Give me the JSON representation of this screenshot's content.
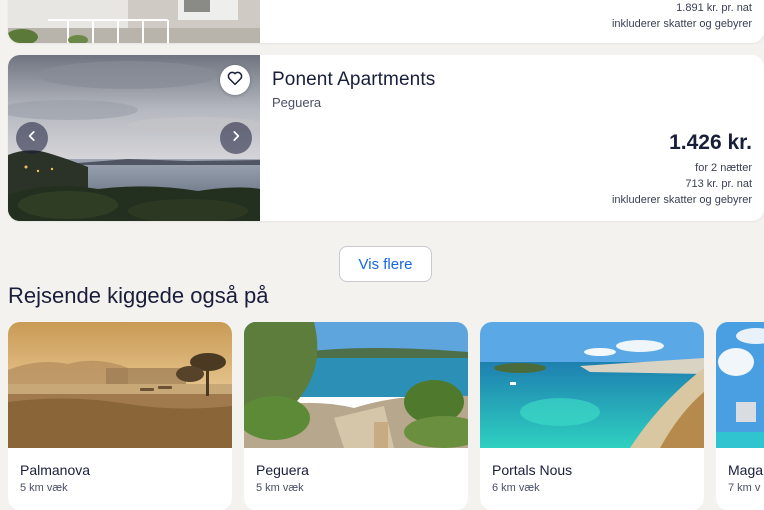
{
  "previous_listing": {
    "price_per_night": "1.891 kr. pr. nat",
    "taxes_note": "inkluderer skatter og gebyrer"
  },
  "listing": {
    "name": "Ponent Apartments",
    "location": "Peguera",
    "total_price": "1.426 kr.",
    "nights": "for 2 nætter",
    "price_per_night": "713 kr. pr. nat",
    "taxes_note": "inkluderer skatter og gebyrer",
    "favorite_icon": "heart-outline",
    "prev_icon": "chevron-left",
    "next_icon": "chevron-right"
  },
  "show_more_label": "Vis flere",
  "also_viewed": {
    "title": "Rejsende kiggede også på",
    "items": [
      {
        "name": "Palmanova",
        "distance": "5 km væk"
      },
      {
        "name": "Peguera",
        "distance": "5 km væk"
      },
      {
        "name": "Portals Nous",
        "distance": "6 km væk"
      },
      {
        "name": "Maga",
        "distance": "7 km v"
      }
    ]
  },
  "colors": {
    "accent": "#1668e3",
    "text": "#191e3b",
    "background": "#f4f2ef"
  }
}
